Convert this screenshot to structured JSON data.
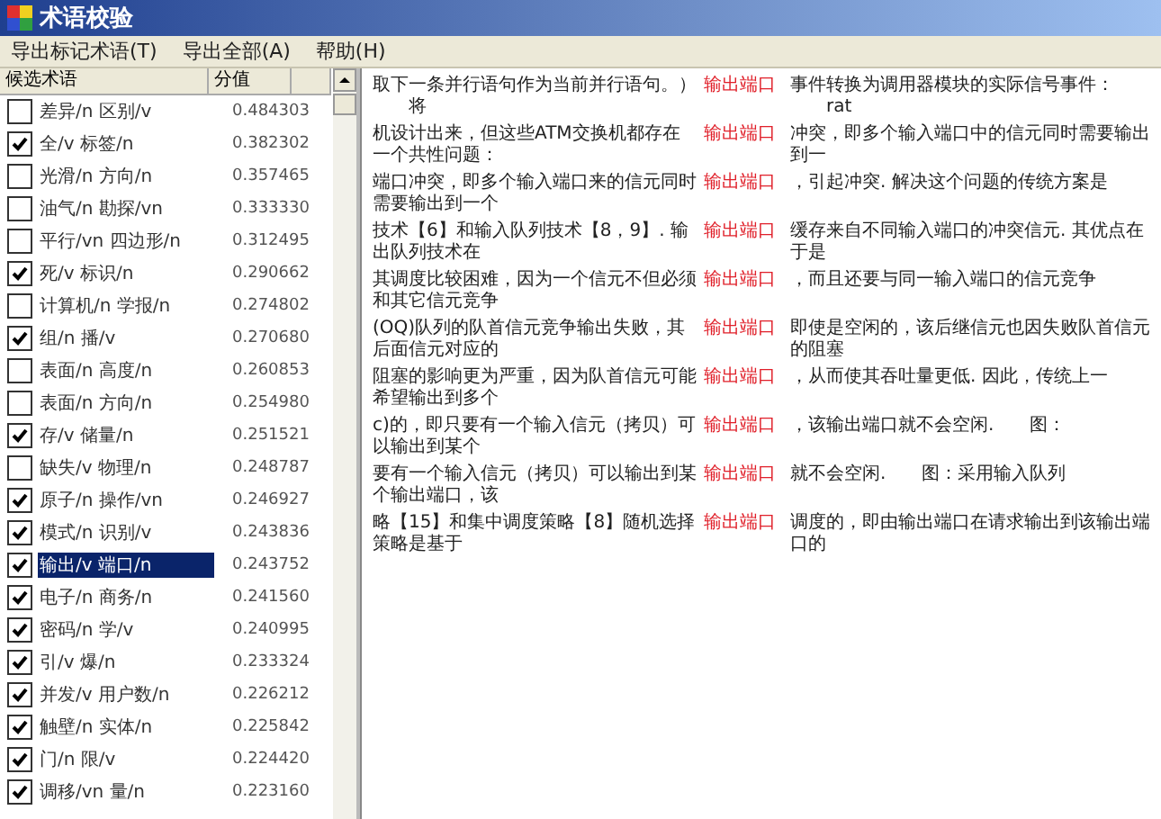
{
  "window": {
    "title": "术语校验"
  },
  "menu": [
    {
      "label": "导出标记术语(T)"
    },
    {
      "label": "导出全部(A)"
    },
    {
      "label": "帮助(H)"
    }
  ],
  "term_list": {
    "columns": [
      "候选术语",
      "分值"
    ],
    "rows": [
      {
        "term": "差异/n 区别/v",
        "score": "0.484303",
        "checked": false,
        "selected": false
      },
      {
        "term": "全/v 标签/n",
        "score": "0.382302",
        "checked": true,
        "selected": false
      },
      {
        "term": "光滑/n 方向/n",
        "score": "0.357465",
        "checked": false,
        "selected": false
      },
      {
        "term": "油气/n 勘探/vn",
        "score": "0.333330",
        "checked": false,
        "selected": false
      },
      {
        "term": "平行/vn 四边形/n",
        "score": "0.312495",
        "checked": false,
        "selected": false
      },
      {
        "term": "死/v 标识/n",
        "score": "0.290662",
        "checked": true,
        "selected": false
      },
      {
        "term": "计算机/n 学报/n",
        "score": "0.274802",
        "checked": false,
        "selected": false
      },
      {
        "term": "组/n 播/v",
        "score": "0.270680",
        "checked": true,
        "selected": false
      },
      {
        "term": "表面/n 高度/n",
        "score": "0.260853",
        "checked": false,
        "selected": false
      },
      {
        "term": "表面/n 方向/n",
        "score": "0.254980",
        "checked": false,
        "selected": false
      },
      {
        "term": "存/v 储量/n",
        "score": "0.251521",
        "checked": true,
        "selected": false
      },
      {
        "term": "缺失/v 物理/n",
        "score": "0.248787",
        "checked": false,
        "selected": false
      },
      {
        "term": "原子/n 操作/vn",
        "score": "0.246927",
        "checked": true,
        "selected": false
      },
      {
        "term": "模式/n 识别/v",
        "score": "0.243836",
        "checked": true,
        "selected": false
      },
      {
        "term": "输出/v 端口/n",
        "score": "0.243752",
        "checked": true,
        "selected": true
      },
      {
        "term": "电子/n 商务/n",
        "score": "0.241560",
        "checked": true,
        "selected": false
      },
      {
        "term": "密码/n 学/v",
        "score": "0.240995",
        "checked": true,
        "selected": false
      },
      {
        "term": "引/v 爆/n",
        "score": "0.233324",
        "checked": true,
        "selected": false
      },
      {
        "term": "并发/v 用户数/n",
        "score": "0.226212",
        "checked": true,
        "selected": false
      },
      {
        "term": "触壁/n 实体/n",
        "score": "0.225842",
        "checked": true,
        "selected": false
      },
      {
        "term": "门/n 限/v",
        "score": "0.224420",
        "checked": true,
        "selected": false
      },
      {
        "term": "调移/vn 量/n",
        "score": "0.223160",
        "checked": true,
        "selected": false
      }
    ]
  },
  "concordance": [
    {
      "left": "取下一条并行语句作为当前并行语句。）",
      "left_tail": "将",
      "keyword": "输出端口",
      "right": "事件转换为调用器模块的实际信号事件：",
      "right_tail": "rat"
    },
    {
      "left": "机设计出来，但这些ATM交换机都存在一个共性问题：",
      "keyword": "输出端口",
      "right": "冲突，即多个输入端口中的信元同时需要输出到一"
    },
    {
      "left": "端口冲突，即多个输入端口来的信元同时需要输出到一个",
      "keyword": "输出端口",
      "right": "，引起冲突. 解决这个问题的传统方案是"
    },
    {
      "left": "技术【6】和输入队列技术【8，9】. 输出队列技术在",
      "keyword": "输出端口",
      "right": "缓存来自不同输入端口的冲突信元. 其优点在于是"
    },
    {
      "left": "其调度比较困难，因为一个信元不但必须和其它信元竞争",
      "keyword": "输出端口",
      "right": "，而且还要与同一输入端口的信元竞争"
    },
    {
      "left": "(OQ)队列的队首信元竞争输出失败，其后面信元对应的",
      "keyword": "输出端口",
      "right": "即使是空闲的，该后继信元也因失败队首信元的阻塞"
    },
    {
      "left": "阻塞的影响更为严重，因为队首信元可能希望输出到多个",
      "keyword": "输出端口",
      "right": "，从而使其吞吐量更低. 因此，传统上一"
    },
    {
      "left": "c)的，即只要有一个输入信元（拷贝）可以输出到某个",
      "keyword": "输出端口",
      "right": "，该输出端口就不会空闲.",
      "right_tail": "图："
    },
    {
      "left": "要有一个输入信元（拷贝）可以输出到某个输出端口，该",
      "keyword": "输出端口",
      "right": "就不会空闲.",
      "right_tail": "图：采用输入队列"
    },
    {
      "left": "略【15】和集中调度策略【8】随机选择策略是基于",
      "keyword": "输出端口",
      "right": "调度的，即由输出端口在请求输出到该输出端口的"
    }
  ]
}
